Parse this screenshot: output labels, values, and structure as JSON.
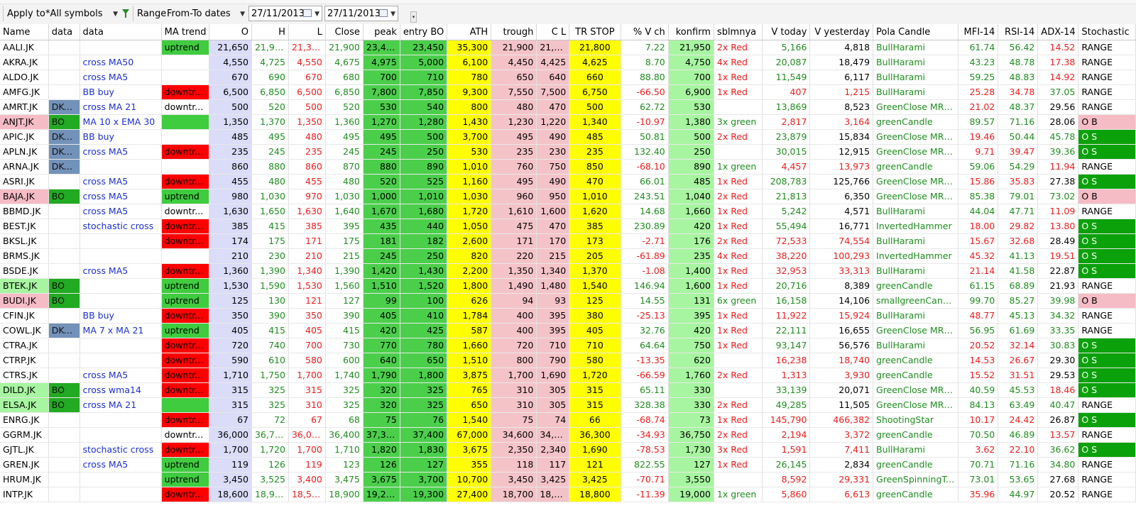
{
  "toolbar": {
    "apply_label": "Apply to",
    "apply_value": "*All symbols",
    "range_label": "Range",
    "range_value": "From-To dates",
    "date_from": "27/11/2013",
    "date_to": "27/11/2013"
  },
  "columns": [
    "Name",
    "data",
    "data",
    "MA trend",
    "O",
    "H",
    "L",
    "Close",
    "peak",
    "entry BO",
    "ATH",
    "trough",
    "C L",
    "TR STOP",
    "% V ch",
    "konfirm",
    "sblmnya",
    "V today",
    "V yesterday",
    "Pola Candle",
    "MFI-14",
    "RSI-14",
    "ADX-14",
    "Stochastic"
  ],
  "colors": {
    "lavender": "#dadcf8",
    "green": "#4bcf4b",
    "yellow": "#ffff00",
    "pink": "#f4c3c8",
    "light_green": "#a7f5a0",
    "red": "#ff0000",
    "dkt_blue": "#7392b9",
    "os_green": "#0ba10b"
  },
  "rows": [
    {
      "name": "AALI.JK",
      "d1": "",
      "d2": "",
      "ma": "uptrend",
      "o": "21,650",
      "h": "21,900",
      "l": "21,300",
      "close": "21,900",
      "peak": "23,400",
      "entry": "23,450",
      "ath": "35,300",
      "trough": "21,900",
      "cl": "21,8...",
      "tr": "21,800",
      "vch": "7.22",
      "konfirm": "21,950",
      "sbl": "2x Red",
      "vtoday": "5,166",
      "vyest": "4,818",
      "pola": "BullHarami",
      "mfi": "61.74",
      "rsi": "56.42",
      "adx": "14.52",
      "stoch": "RANGE"
    },
    {
      "name": "AKRA.JK",
      "d1": "",
      "d2": "cross MA50",
      "ma": "",
      "o": "4,550",
      "h": "4,725",
      "l": "4,550",
      "close": "4,675",
      "peak": "4,975",
      "entry": "5,000",
      "ath": "6,100",
      "trough": "4,450",
      "cl": "4,425",
      "tr": "4,625",
      "vch": "8.70",
      "konfirm": "4,750",
      "sbl": "4x Red",
      "vtoday": "20,087",
      "vyest": "18,479",
      "pola": "BullHarami",
      "mfi": "43.23",
      "rsi": "48.78",
      "adx": "17.38",
      "stoch": "RANGE"
    },
    {
      "name": "ALDO.JK",
      "d1": "",
      "d2": "cross MA5",
      "ma": "",
      "o": "670",
      "h": "690",
      "l": "670",
      "close": "680",
      "peak": "700",
      "entry": "710",
      "ath": "780",
      "trough": "650",
      "cl": "640",
      "tr": "660",
      "vch": "88.80",
      "konfirm": "700",
      "sbl": "1x Red",
      "vtoday": "11,549",
      "vyest": "6,117",
      "pola": "BullHarami",
      "mfi": "59.25",
      "rsi": "48.83",
      "adx": "14.92",
      "stoch": "RANGE"
    },
    {
      "name": "AMFG.JK",
      "d1": "",
      "d2": "BB buy",
      "ma": "downtr...",
      "o": "6,500",
      "h": "6,850",
      "l": "6,500",
      "close": "6,850",
      "peak": "7,800",
      "entry": "7,850",
      "ath": "9,300",
      "trough": "7,550",
      "cl": "7,500",
      "tr": "6,750",
      "vch": "-66.50",
      "konfirm": "6,900",
      "sbl": "1x Red",
      "vtoday": "407",
      "vyest": "1,215",
      "pola": "BullHarami",
      "mfi": "25.28",
      "rsi": "34.78",
      "adx": "37.05",
      "stoch": "RANGE"
    },
    {
      "name": "AMRT.JK",
      "d1": "DKT...",
      "d2": "cross MA 21",
      "ma": "downtr...",
      "o": "500",
      "h": "520",
      "l": "500",
      "close": "520",
      "peak": "530",
      "entry": "540",
      "ath": "800",
      "trough": "480",
      "cl": "470",
      "tr": "500",
      "vch": "62.72",
      "konfirm": "530",
      "sbl": "",
      "vtoday": "13,869",
      "vyest": "8,523",
      "pola": "GreenClose MRBZ",
      "mfi": "21.02",
      "rsi": "48.37",
      "adx": "29.56",
      "stoch": "RANGE"
    },
    {
      "name": "ANJT.JK",
      "d1": "BO",
      "d2": "MA 10 x EMA 30",
      "ma": "",
      "o": "1,350",
      "h": "1,370",
      "l": "1,350",
      "close": "1,360",
      "peak": "1,270",
      "entry": "1,280",
      "ath": "1,430",
      "trough": "1,230",
      "cl": "1,220",
      "tr": "1,340",
      "vch": "-10.97",
      "konfirm": "1,380",
      "sbl": "3x green",
      "vtoday": "2,817",
      "vyest": "3,164",
      "pola": "greenCandle",
      "mfi": "89.57",
      "rsi": "71.16",
      "adx": "28.06",
      "stoch": "O B"
    },
    {
      "name": "APIC.JK",
      "d1": "DKT...",
      "d2": "BB buy",
      "ma": "",
      "o": "485",
      "h": "495",
      "l": "480",
      "close": "495",
      "peak": "495",
      "entry": "500",
      "ath": "3,700",
      "trough": "495",
      "cl": "490",
      "tr": "485",
      "vch": "50.81",
      "konfirm": "500",
      "sbl": "2x Red",
      "vtoday": "23,879",
      "vyest": "15,834",
      "pola": "GreenClose MRBZ",
      "mfi": "19.46",
      "rsi": "50.44",
      "adx": "45.78",
      "stoch": "O S"
    },
    {
      "name": "APLN.JK",
      "d1": "DKT...",
      "d2": "cross MA5",
      "ma": "downtr...",
      "o": "235",
      "h": "245",
      "l": "235",
      "close": "245",
      "peak": "245",
      "entry": "250",
      "ath": "530",
      "trough": "235",
      "cl": "230",
      "tr": "235",
      "vch": "132.40",
      "konfirm": "250",
      "sbl": "",
      "vtoday": "30,015",
      "vyest": "12,915",
      "pola": "GreenClose MRBZ",
      "mfi": "9.71",
      "rsi": "39.47",
      "adx": "39.36",
      "stoch": "O S"
    },
    {
      "name": "ARNA.JK",
      "d1": "DKT...",
      "d2": "",
      "ma": "",
      "o": "860",
      "h": "880",
      "l": "860",
      "close": "870",
      "peak": "880",
      "entry": "890",
      "ath": "1,010",
      "trough": "760",
      "cl": "750",
      "tr": "850",
      "vch": "-68.10",
      "konfirm": "890",
      "sbl": "1x green",
      "vtoday": "4,457",
      "vyest": "13,973",
      "pola": "greenCandle",
      "mfi": "59.06",
      "rsi": "54.29",
      "adx": "11.94",
      "stoch": "RANGE"
    },
    {
      "name": "ASRI.JK",
      "d1": "",
      "d2": "cross MA5",
      "ma": "downtr...",
      "o": "455",
      "h": "480",
      "l": "455",
      "close": "480",
      "peak": "520",
      "entry": "525",
      "ath": "1,160",
      "trough": "495",
      "cl": "490",
      "tr": "470",
      "vch": "66.01",
      "konfirm": "485",
      "sbl": "1x Red",
      "vtoday": "208,783",
      "vyest": "125,766",
      "pola": "GreenClose MRBZ",
      "mfi": "15.86",
      "rsi": "35.83",
      "adx": "27.38",
      "stoch": "O S"
    },
    {
      "name": "BAJA.JK",
      "d1": "BO",
      "d2": "cross MA5",
      "ma": "uptrend",
      "o": "980",
      "h": "1,030",
      "l": "970",
      "close": "1,030",
      "peak": "1,000",
      "entry": "1,010",
      "ath": "1,030",
      "trough": "960",
      "cl": "950",
      "tr": "1,010",
      "vch": "243.51",
      "konfirm": "1,040",
      "sbl": "2x Red",
      "vtoday": "21,813",
      "vyest": "6,350",
      "pola": "GreenClose MRBZ",
      "mfi": "85.38",
      "rsi": "79.01",
      "adx": "73.02",
      "stoch": "O B"
    },
    {
      "name": "BBMD.JK",
      "d1": "",
      "d2": "cross MA5",
      "ma": "downtr...",
      "o": "1,630",
      "h": "1,650",
      "l": "1,630",
      "close": "1,640",
      "peak": "1,670",
      "entry": "1,680",
      "ath": "1,720",
      "trough": "1,610",
      "cl": "1,600",
      "tr": "1,620",
      "vch": "14.68",
      "konfirm": "1,660",
      "sbl": "1x Red",
      "vtoday": "5,242",
      "vyest": "4,571",
      "pola": "BullHarami",
      "mfi": "44.04",
      "rsi": "47.71",
      "adx": "11.09",
      "stoch": "RANGE"
    },
    {
      "name": "BEST.JK",
      "d1": "",
      "d2": "stochastic cross",
      "ma": "downtr...",
      "o": "385",
      "h": "415",
      "l": "385",
      "close": "395",
      "peak": "435",
      "entry": "440",
      "ath": "1,050",
      "trough": "475",
      "cl": "470",
      "tr": "385",
      "vch": "230.89",
      "konfirm": "420",
      "sbl": "1x Red",
      "vtoday": "55,494",
      "vyest": "16,771",
      "pola": "InvertedHammer",
      "mfi": "18.00",
      "rsi": "29.82",
      "adx": "13.80",
      "stoch": "O S"
    },
    {
      "name": "BKSL.JK",
      "d1": "",
      "d2": "",
      "ma": "downtr...",
      "o": "174",
      "h": "175",
      "l": "171",
      "close": "175",
      "peak": "181",
      "entry": "182",
      "ath": "2,600",
      "trough": "171",
      "cl": "170",
      "tr": "173",
      "vch": "-2.71",
      "konfirm": "176",
      "sbl": "2x Red",
      "vtoday": "72,533",
      "vyest": "74,554",
      "pola": "BullHarami",
      "mfi": "15.67",
      "rsi": "32.68",
      "adx": "28.49",
      "stoch": "O S"
    },
    {
      "name": "BRMS.JK",
      "d1": "",
      "d2": "",
      "ma": "",
      "o": "210",
      "h": "230",
      "l": "210",
      "close": "215",
      "peak": "245",
      "entry": "250",
      "ath": "820",
      "trough": "220",
      "cl": "215",
      "tr": "205",
      "vch": "-61.89",
      "konfirm": "235",
      "sbl": "4x Red",
      "vtoday": "38,220",
      "vyest": "100,293",
      "pola": "InvertedHammer",
      "mfi": "45.32",
      "rsi": "41.13",
      "adx": "19.51",
      "stoch": "O S"
    },
    {
      "name": "BSDE.JK",
      "d1": "",
      "d2": "cross MA5",
      "ma": "downtr...",
      "o": "1,360",
      "h": "1,390",
      "l": "1,340",
      "close": "1,390",
      "peak": "1,420",
      "entry": "1,430",
      "ath": "2,200",
      "trough": "1,350",
      "cl": "1,340",
      "tr": "1,370",
      "vch": "-1.08",
      "konfirm": "1,400",
      "sbl": "1x Red",
      "vtoday": "32,953",
      "vyest": "33,313",
      "pola": "BullHarami",
      "mfi": "21.14",
      "rsi": "41.58",
      "adx": "22.87",
      "stoch": "O S"
    },
    {
      "name": "BTEK.JK",
      "d1": "BO",
      "d2": "",
      "ma": "uptrend",
      "o": "1,530",
      "h": "1,590",
      "l": "1,530",
      "close": "1,560",
      "peak": "1,510",
      "entry": "1,520",
      "ath": "1,800",
      "trough": "1,490",
      "cl": "1,480",
      "tr": "1,540",
      "vch": "146.94",
      "konfirm": "1,600",
      "sbl": "1x Red",
      "vtoday": "20,716",
      "vyest": "8,389",
      "pola": "greenCandle",
      "mfi": "61.15",
      "rsi": "68.89",
      "adx": "21.93",
      "stoch": "RANGE"
    },
    {
      "name": "BUDI.JK",
      "d1": "BO",
      "d2": "",
      "ma": "uptrend",
      "o": "125",
      "h": "130",
      "l": "121",
      "close": "127",
      "peak": "99",
      "entry": "100",
      "ath": "626",
      "trough": "94",
      "cl": "93",
      "tr": "125",
      "vch": "14.55",
      "konfirm": "131",
      "sbl": "6x green",
      "vtoday": "16,158",
      "vyest": "14,106",
      "pola": "smallgreenCandle",
      "mfi": "99.70",
      "rsi": "85.27",
      "adx": "39.98",
      "stoch": "O B"
    },
    {
      "name": "CFIN.JK",
      "d1": "",
      "d2": "BB buy",
      "ma": "downtr...",
      "o": "350",
      "h": "390",
      "l": "350",
      "close": "390",
      "peak": "405",
      "entry": "410",
      "ath": "1,784",
      "trough": "400",
      "cl": "395",
      "tr": "380",
      "vch": "-25.13",
      "konfirm": "395",
      "sbl": "1x Red",
      "vtoday": "11,922",
      "vyest": "15,924",
      "pola": "BullHarami",
      "mfi": "48.77",
      "rsi": "45.13",
      "adx": "34.32",
      "stoch": "RANGE"
    },
    {
      "name": "COWL.JK",
      "d1": "DKT...",
      "d2": "MA 7 x MA 21",
      "ma": "uptrend",
      "o": "405",
      "h": "415",
      "l": "405",
      "close": "415",
      "peak": "420",
      "entry": "425",
      "ath": "587",
      "trough": "400",
      "cl": "395",
      "tr": "405",
      "vch": "32.76",
      "konfirm": "420",
      "sbl": "1x Red",
      "vtoday": "22,111",
      "vyest": "16,655",
      "pola": "GreenClose MRBZ",
      "mfi": "56.95",
      "rsi": "61.69",
      "adx": "33.35",
      "stoch": "RANGE"
    },
    {
      "name": "CTRA.JK",
      "d1": "",
      "d2": "",
      "ma": "downtr...",
      "o": "720",
      "h": "740",
      "l": "700",
      "close": "730",
      "peak": "770",
      "entry": "780",
      "ath": "1,660",
      "trough": "720",
      "cl": "710",
      "tr": "710",
      "vch": "64.64",
      "konfirm": "750",
      "sbl": "1x Red",
      "vtoday": "93,147",
      "vyest": "56,576",
      "pola": "BullHarami",
      "mfi": "20.52",
      "rsi": "32.14",
      "adx": "30.83",
      "stoch": "O S"
    },
    {
      "name": "CTRP.JK",
      "d1": "",
      "d2": "",
      "ma": "downtr...",
      "o": "590",
      "h": "610",
      "l": "580",
      "close": "600",
      "peak": "640",
      "entry": "650",
      "ath": "1,510",
      "trough": "800",
      "cl": "790",
      "tr": "580",
      "vch": "-13.35",
      "konfirm": "620",
      "sbl": "",
      "vtoday": "16,238",
      "vyest": "18,740",
      "pola": "greenCandle",
      "mfi": "14.53",
      "rsi": "26.67",
      "adx": "29.30",
      "stoch": "O S"
    },
    {
      "name": "CTRS.JK",
      "d1": "",
      "d2": "cross MA5",
      "ma": "downtr...",
      "o": "1,710",
      "h": "1,750",
      "l": "1,700",
      "close": "1,740",
      "peak": "1,790",
      "entry": "1,800",
      "ath": "3,875",
      "trough": "1,700",
      "cl": "1,690",
      "tr": "1,720",
      "vch": "-66.59",
      "konfirm": "1,760",
      "sbl": "2x Red",
      "vtoday": "1,313",
      "vyest": "3,930",
      "pola": "greenCandle",
      "mfi": "15.52",
      "rsi": "31.51",
      "adx": "29.53",
      "stoch": "O S"
    },
    {
      "name": "DILD.JK",
      "d1": "BO",
      "d2": "cross wma14",
      "ma": "downtr...",
      "o": "315",
      "h": "325",
      "l": "315",
      "close": "325",
      "peak": "320",
      "entry": "325",
      "ath": "765",
      "trough": "310",
      "cl": "305",
      "tr": "315",
      "vch": "65.11",
      "konfirm": "330",
      "sbl": "",
      "vtoday": "33,139",
      "vyest": "20,071",
      "pola": "GreenClose MRBZ",
      "mfi": "40.59",
      "rsi": "45.53",
      "adx": "18.46",
      "stoch": "O S"
    },
    {
      "name": "ELSA.JK",
      "d1": "BO",
      "d2": "cross MA 21",
      "ma": "",
      "o": "315",
      "h": "325",
      "l": "310",
      "close": "325",
      "peak": "320",
      "entry": "325",
      "ath": "650",
      "trough": "310",
      "cl": "305",
      "tr": "315",
      "vch": "328.38",
      "konfirm": "330",
      "sbl": "2x Red",
      "vtoday": "49,285",
      "vyest": "11,505",
      "pola": "GreenClose MRBZ",
      "mfi": "84.13",
      "rsi": "63.49",
      "adx": "40.47",
      "stoch": "RANGE"
    },
    {
      "name": "ENRG.JK",
      "d1": "",
      "d2": "",
      "ma": "downtr...",
      "o": "67",
      "h": "72",
      "l": "67",
      "close": "68",
      "peak": "75",
      "entry": "76",
      "ath": "1,540",
      "trough": "75",
      "cl": "74",
      "tr": "66",
      "vch": "-68.74",
      "konfirm": "73",
      "sbl": "1x Red",
      "vtoday": "145,790",
      "vyest": "466,382",
      "pola": "ShootingStar",
      "mfi": "10.17",
      "rsi": "24.42",
      "adx": "26.87",
      "stoch": "O S"
    },
    {
      "name": "GGRM.JK",
      "d1": "",
      "d2": "",
      "ma": "downtr...",
      "o": "36,000",
      "h": "36,700",
      "l": "36,000",
      "close": "36,400",
      "peak": "37,350",
      "entry": "37,400",
      "ath": "67,000",
      "trough": "34,600",
      "cl": "34,5...",
      "tr": "36,300",
      "vch": "-34.93",
      "konfirm": "36,750",
      "sbl": "2x Red",
      "vtoday": "2,194",
      "vyest": "3,372",
      "pola": "greenCandle",
      "mfi": "70.50",
      "rsi": "46.89",
      "adx": "13.57",
      "stoch": "RANGE"
    },
    {
      "name": "GJTL.JK",
      "d1": "",
      "d2": "stochastic cross",
      "ma": "downtr...",
      "o": "1,700",
      "h": "1,720",
      "l": "1,700",
      "close": "1,710",
      "peak": "1,820",
      "entry": "1,830",
      "ath": "3,675",
      "trough": "2,350",
      "cl": "2,340",
      "tr": "1,690",
      "vch": "-78.53",
      "konfirm": "1,730",
      "sbl": "3x Red",
      "vtoday": "1,591",
      "vyest": "7,411",
      "pola": "BullHarami",
      "mfi": "3.62",
      "rsi": "22.10",
      "adx": "36.62",
      "stoch": "O S"
    },
    {
      "name": "GREN.JK",
      "d1": "",
      "d2": "cross MA5",
      "ma": "uptrend",
      "o": "119",
      "h": "126",
      "l": "119",
      "close": "123",
      "peak": "126",
      "entry": "127",
      "ath": "355",
      "trough": "118",
      "cl": "117",
      "tr": "121",
      "vch": "822.55",
      "konfirm": "127",
      "sbl": "1x Red",
      "vtoday": "26,145",
      "vyest": "2,834",
      "pola": "greenCandle",
      "mfi": "70.71",
      "rsi": "71.16",
      "adx": "34.80",
      "stoch": "RANGE"
    },
    {
      "name": "HRUM.JK",
      "d1": "",
      "d2": "",
      "ma": "uptrend",
      "o": "3,450",
      "h": "3,525",
      "l": "3,400",
      "close": "3,475",
      "peak": "3,675",
      "entry": "3,700",
      "ath": "10,700",
      "trough": "3,450",
      "cl": "3,425",
      "tr": "3,425",
      "vch": "-70.71",
      "konfirm": "3,550",
      "sbl": "",
      "vtoday": "8,592",
      "vyest": "29,331",
      "pola": "GreenSpinningTop",
      "mfi": "73.01",
      "rsi": "53.65",
      "adx": "27.68",
      "stoch": "RANGE"
    },
    {
      "name": "INTP.JK",
      "d1": "",
      "d2": "",
      "ma": "downtr...",
      "o": "18,600",
      "h": "18,950",
      "l": "18,500",
      "close": "18,900",
      "peak": "19,250",
      "entry": "19,300",
      "ath": "27,400",
      "trough": "18,700",
      "cl": "18,6...",
      "tr": "18,800",
      "vch": "-11.39",
      "konfirm": "19,000",
      "sbl": "1x green",
      "vtoday": "5,860",
      "vyest": "6,613",
      "pola": "greenCandle",
      "mfi": "35.96",
      "rsi": "44.97",
      "adx": "20.52",
      "stoch": "RANGE"
    }
  ]
}
